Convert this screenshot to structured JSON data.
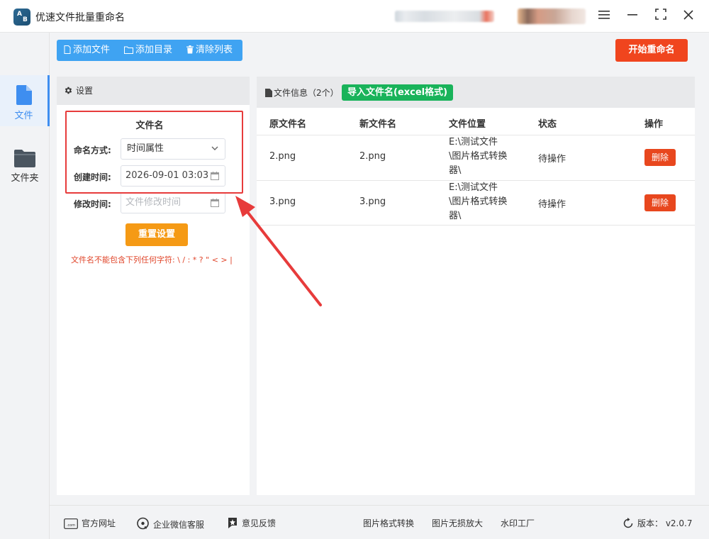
{
  "window": {
    "title": "优速文件批量重命名",
    "logo_text": [
      "A",
      "B"
    ],
    "controls": [
      "menu-icon",
      "minimize-icon",
      "maximize-icon",
      "close-icon"
    ]
  },
  "leftnav": {
    "items": [
      {
        "label": "文件",
        "icon": "file-icon",
        "active": true
      },
      {
        "label": "文件夹",
        "icon": "folder-icon",
        "active": false
      }
    ]
  },
  "toolbar": {
    "add_file": "添加文件",
    "add_dir": "添加目录",
    "clear_list": "清除列表",
    "start_rename": "开始重命名"
  },
  "settings": {
    "header": "设置",
    "section_title": "文件名",
    "naming_label": "命名方式:",
    "naming_value": "时间属性",
    "created_label": "创建时间:",
    "created_value": "2026-09-01 03:03",
    "modified_label": "修改时间:",
    "modified_placeholder": "文件修改时间",
    "reset_button": "重置设置",
    "warning": "文件名不能包含下列任何字符: \\ / : * ? \" < > |"
  },
  "files": {
    "header_label": "文件信息",
    "count": "（2个）",
    "import_button": "导入文件名(excel格式)",
    "columns": [
      "原文件名",
      "新文件名",
      "文件位置",
      "状态",
      "操作"
    ],
    "rows": [
      {
        "original": "2.png",
        "new": "2.png",
        "path": [
          "E:\\测试文件",
          "\\图片格式转换",
          "器\\"
        ],
        "status": "待操作",
        "action": "删除"
      },
      {
        "original": "3.png",
        "new": "3.png",
        "path": [
          "E:\\测试文件",
          "\\图片格式转换",
          "器\\"
        ],
        "status": "待操作",
        "action": "删除"
      }
    ]
  },
  "footer": {
    "website": "官方网址",
    "wechat": "企业微信客服",
    "feedback": "意见反馈",
    "img_convert": "图片格式转换",
    "img_enlarge": "图片无损放大",
    "watermark": "水印工厂",
    "version": "版本： v2.0.7",
    "website_icon_text": ".com"
  },
  "colors": {
    "accent_blue": "#3fa3f2",
    "start_red": "#f0451e",
    "reset_orange": "#f59a15",
    "import_green": "#19b35a",
    "annotation_red": "#e73b3b"
  }
}
